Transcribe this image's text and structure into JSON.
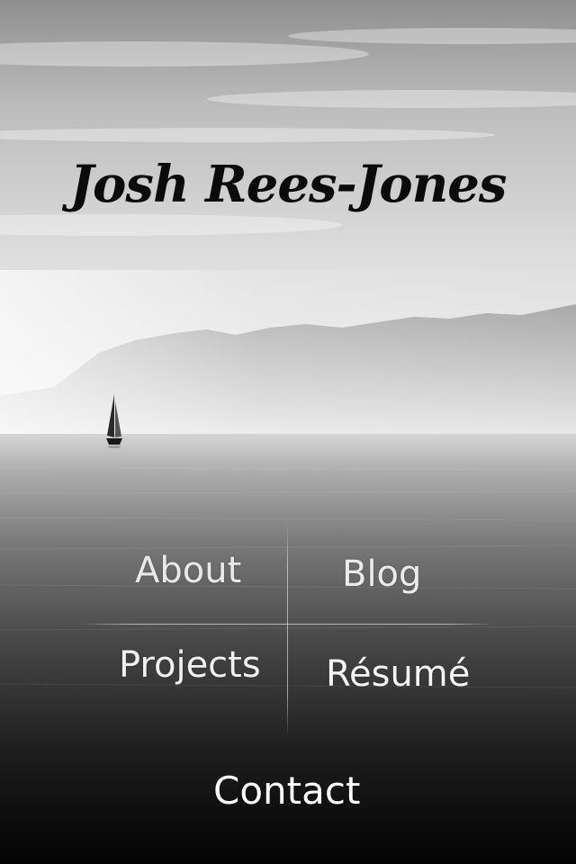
{
  "header": {
    "title": "Josh Rees-Jones"
  },
  "nav": {
    "about": "About",
    "blog": "Blog",
    "projects": "Projects",
    "resume": "Résumé",
    "contact": "Contact"
  },
  "background": {
    "icon": "sailboat-icon",
    "colors": {
      "sky": "#e6e6e6",
      "mountains": "#b5b5b5",
      "water_dark": "#050505"
    }
  }
}
